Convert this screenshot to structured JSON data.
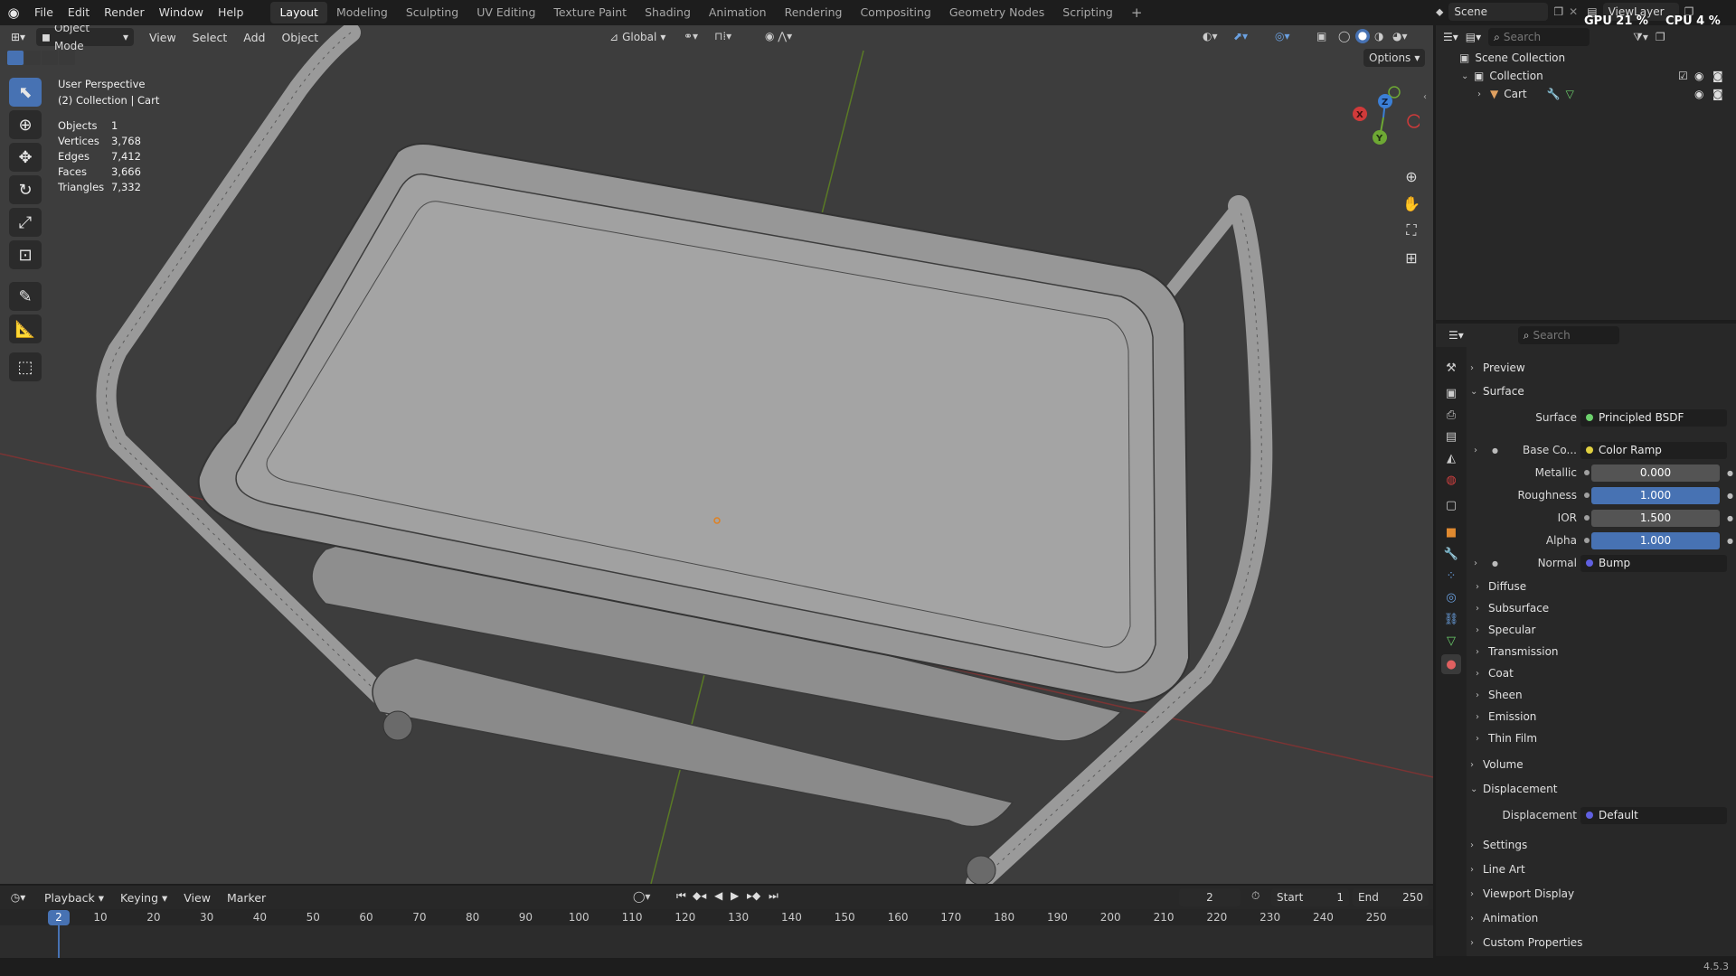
{
  "topbar": {
    "menus": [
      "File",
      "Edit",
      "Render",
      "Window",
      "Help"
    ],
    "workspaces": [
      "Layout",
      "Modeling",
      "Sculpting",
      "UV Editing",
      "Texture Paint",
      "Shading",
      "Animation",
      "Rendering",
      "Compositing",
      "Geometry Nodes",
      "Scripting"
    ],
    "active_workspace": "Layout",
    "add_tab": "+",
    "scene": "Scene",
    "view_layer": "ViewLayer",
    "gpu": "GPU 21 %",
    "cpu": "CPU 4 %"
  },
  "viewport": {
    "mode": "Object Mode",
    "menus": [
      "View",
      "Select",
      "Add",
      "Object"
    ],
    "transform": "Global",
    "options": "Options",
    "perspective": "User Perspective",
    "collection_path": "(2) Collection | Cart",
    "stats": [
      {
        "label": "Objects",
        "value": "1"
      },
      {
        "label": "Vertices",
        "value": "3,768"
      },
      {
        "label": "Edges",
        "value": "7,412"
      },
      {
        "label": "Faces",
        "value": "3,666"
      },
      {
        "label": "Triangles",
        "value": "7,332"
      }
    ],
    "gizmo": {
      "x": "X",
      "y": "Y",
      "z": "Z"
    }
  },
  "outliner": {
    "search_placeholder": "Search",
    "scene_collection": "Scene Collection",
    "collection": "Collection",
    "object": "Cart"
  },
  "properties": {
    "search_placeholder": "Search",
    "sections_top": [
      "Preview",
      "Surface"
    ],
    "surface": {
      "surface_label": "Surface",
      "surface_value": "Principled BSDF",
      "base_label": "Base Co...",
      "base_value": "Color Ramp",
      "metallic_label": "Metallic",
      "metallic_value": "0.000",
      "roughness_label": "Roughness",
      "roughness_value": "1.000",
      "ior_label": "IOR",
      "ior_value": "1.500",
      "alpha_label": "Alpha",
      "alpha_value": "1.000",
      "normal_label": "Normal",
      "normal_value": "Bump"
    },
    "sub_sections": [
      "Diffuse",
      "Subsurface",
      "Specular",
      "Transmission",
      "Coat",
      "Sheen",
      "Emission",
      "Thin Film"
    ],
    "volume": "Volume",
    "displacement": "Displacement",
    "displacement_label": "Displacement",
    "displacement_value": "Default",
    "bottom_sections": [
      "Settings",
      "Line Art",
      "Viewport Display",
      "Animation",
      "Custom Properties"
    ]
  },
  "timeline": {
    "menus": [
      "Playback",
      "Keying",
      "View",
      "Marker"
    ],
    "current_frame": "2",
    "start_label": "Start",
    "start": "1",
    "end_label": "End",
    "end": "250",
    "ticks": [
      "10",
      "20",
      "30",
      "40",
      "50",
      "60",
      "70",
      "80",
      "90",
      "100",
      "110",
      "120",
      "130",
      "140",
      "150",
      "160",
      "170",
      "180",
      "190",
      "200",
      "210",
      "220",
      "230",
      "240",
      "250"
    ],
    "cursor_label": "2"
  },
  "status": {
    "version": "4.5.3"
  }
}
